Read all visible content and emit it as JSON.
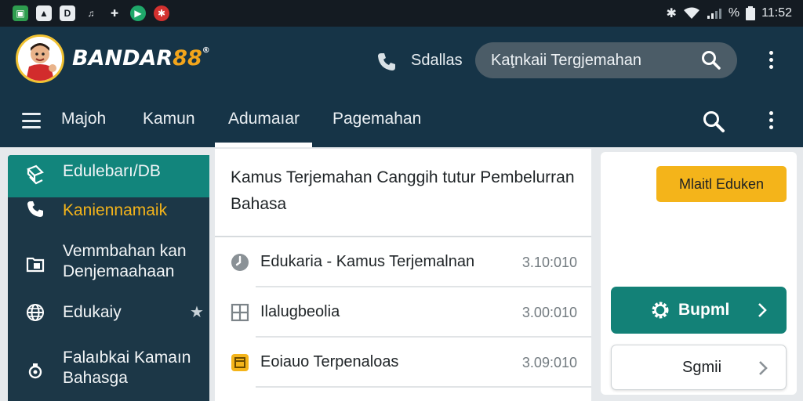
{
  "status_bar": {
    "time": "11:52",
    "battery_pct": "%",
    "left_icons": [
      "image-icon",
      "stats-icon",
      "d-icon",
      "music-icon",
      "game-icon",
      "play-icon",
      "news-icon"
    ]
  },
  "header": {
    "brand_main": "BANDAR",
    "brand_accent": "88",
    "brand_reg": "®",
    "call_label": "Sdallas",
    "search_text": "Kaţnkaii Tergjemahan"
  },
  "nav": {
    "tabs": [
      "Majoh",
      "Kamun",
      "Adumaıar",
      "Pagemahan"
    ],
    "active_tab": 2
  },
  "sidebar": {
    "items": [
      {
        "label": "Edulebarı/DB",
        "icon": "book-icon",
        "active": true
      },
      {
        "label": "Kaniennamaik",
        "icon": "phone-icon",
        "highlight": true
      },
      {
        "label": "Vemmbahan kan Denjemaahaan",
        "icon": "folder-icon"
      },
      {
        "label": "Edukaiy",
        "icon": "globe-icon",
        "pin": "★"
      },
      {
        "label": "Falaıbkai Kamaın Bahasga",
        "icon": "language-icon"
      }
    ]
  },
  "main": {
    "title": "Kamus Terjemahan Canggih tutur Pembelurran Bahasa",
    "rows": [
      {
        "icon": "clock-icon",
        "label": "Edukaria - Kamus Terjemalnan",
        "time": "3.10:010"
      },
      {
        "icon": "grid-icon",
        "label": "Ilalugbeolia",
        "time": "3.00:010"
      },
      {
        "icon": "calendar-icon",
        "label": "Eoiauo Terpenaloas",
        "time": "3.09:010"
      }
    ]
  },
  "right_panel": {
    "yellow_button": "Mlaitl Eduken",
    "teal_button": "Bupml",
    "white_button": "Sgmii"
  },
  "colors": {
    "header_bg": "#163447",
    "accent_teal": "#12857c",
    "accent_yellow": "#f4b41a",
    "brand_orange": "#f2a51b"
  }
}
